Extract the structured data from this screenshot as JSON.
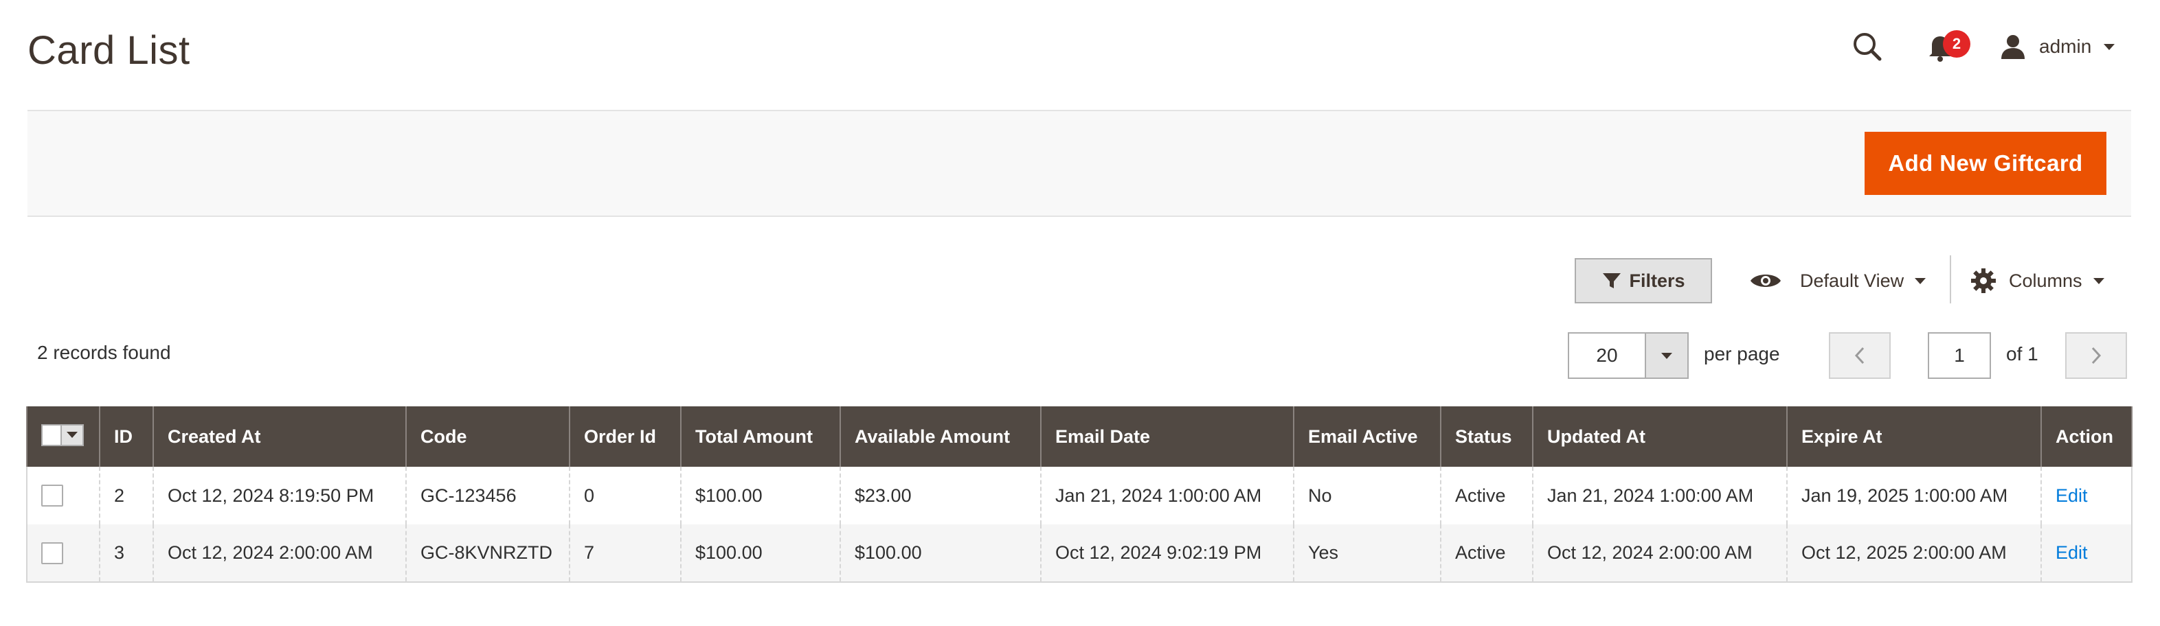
{
  "header": {
    "title": "Card List",
    "notification_count": "2",
    "user_name": "admin"
  },
  "action_bar": {
    "primary_button": "Add New Giftcard",
    "accent_color": "#eb5202"
  },
  "grid_controls": {
    "filters_label": "Filters",
    "view_label": "Default View",
    "columns_label": "Columns",
    "records_found": "2 records found",
    "per_page_value": "20",
    "per_page_label": "per page",
    "current_page": "1",
    "of_pages": "of 1"
  },
  "table": {
    "columns": [
      "ID",
      "Created At",
      "Code",
      "Order Id",
      "Total Amount",
      "Available Amount",
      "Email Date",
      "Email Active",
      "Status",
      "Updated At",
      "Expire At",
      "Action"
    ],
    "rows": [
      {
        "id": "2",
        "created_at": "Oct 12, 2024 8:19:50 PM",
        "code": "GC-123456",
        "order_id": "0",
        "total_amount": "$100.00",
        "available_amount": "$23.00",
        "email_date": "Jan 21, 2024 1:00:00 AM",
        "email_active": "No",
        "status": "Active",
        "updated_at": "Jan 21, 2024 1:00:00 AM",
        "expire_at": "Jan 19, 2025 1:00:00 AM",
        "action": "Edit"
      },
      {
        "id": "3",
        "created_at": "Oct 12, 2024 2:00:00 AM",
        "code": "GC-8KVNRZTD",
        "order_id": "7",
        "total_amount": "$100.00",
        "available_amount": "$100.00",
        "email_date": "Oct 12, 2024 9:02:19 PM",
        "email_active": "Yes",
        "status": "Active",
        "updated_at": "Oct 12, 2024 2:00:00 AM",
        "expire_at": "Oct 12, 2025 2:00:00 AM",
        "action": "Edit"
      }
    ]
  }
}
